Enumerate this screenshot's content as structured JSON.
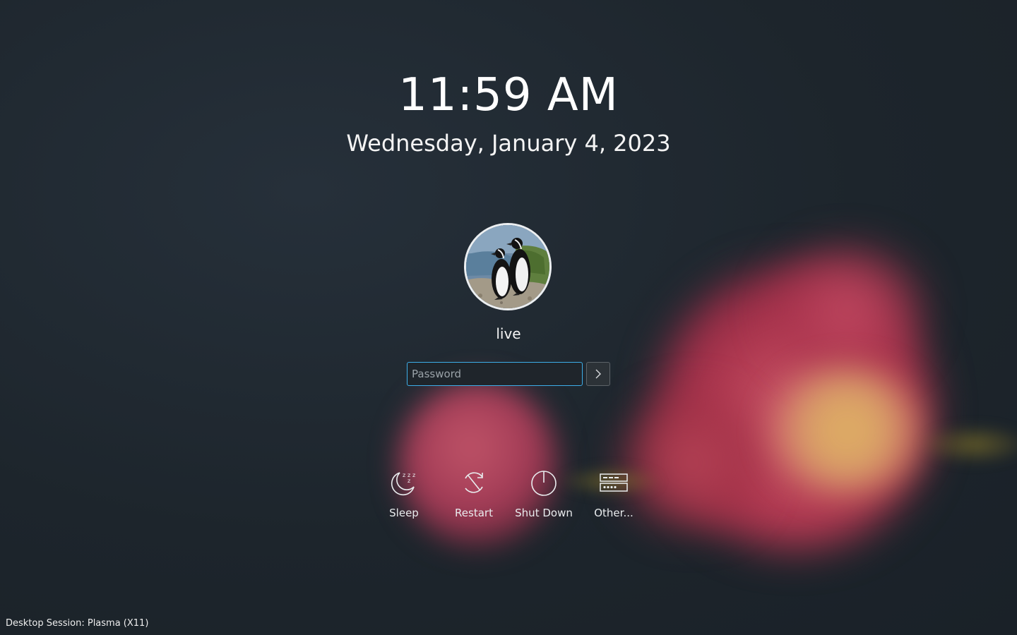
{
  "clock": {
    "time": "11:59 AM",
    "date": "Wednesday, January 4, 2023"
  },
  "user": {
    "name": "live",
    "avatar_icon": "penguins-avatar"
  },
  "login": {
    "password_placeholder": "Password",
    "password_value": "",
    "submit_icon": "chevron-right-icon"
  },
  "actions": [
    {
      "label": "Sleep",
      "icon": "sleep-icon"
    },
    {
      "label": "Restart",
      "icon": "restart-icon"
    },
    {
      "label": "Shut Down",
      "icon": "power-icon"
    },
    {
      "label": "Other...",
      "icon": "other-sessions-icon"
    }
  ],
  "footer": {
    "session": "Desktop Session: Plasma (X11)"
  },
  "colors": {
    "accent": "#3daee9",
    "background": "#1d252c"
  }
}
